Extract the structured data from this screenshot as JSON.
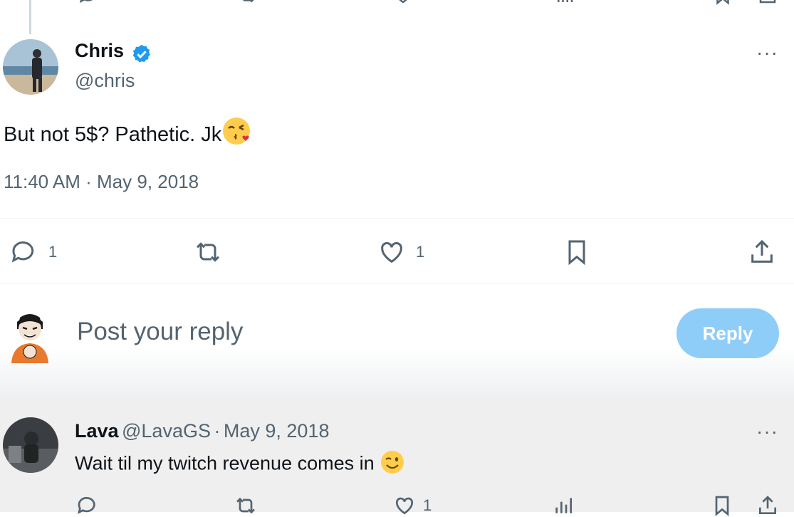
{
  "tweet": {
    "author_name": "Chris",
    "author_handle": "@chris",
    "text": "But not 5$? Pathetic. Jk",
    "emoji": "kissing-winking-face",
    "timestamp": "11:40 AM · May 9, 2018",
    "stats": {
      "replies": "1",
      "likes": "1"
    }
  },
  "composer": {
    "placeholder": "Post your reply",
    "reply_button": "Reply"
  },
  "reply": {
    "author_name": "Lava",
    "author_handle": "@LavaGS",
    "separator": "·",
    "date": "May 9, 2018",
    "text": "Wait til my twitch revenue comes in",
    "emoji": "winking-face",
    "stats": {
      "likes": "1"
    }
  },
  "colors": {
    "verified": "#1d9bf0",
    "muted": "#536471",
    "reply_button": "#8ecdf8"
  }
}
